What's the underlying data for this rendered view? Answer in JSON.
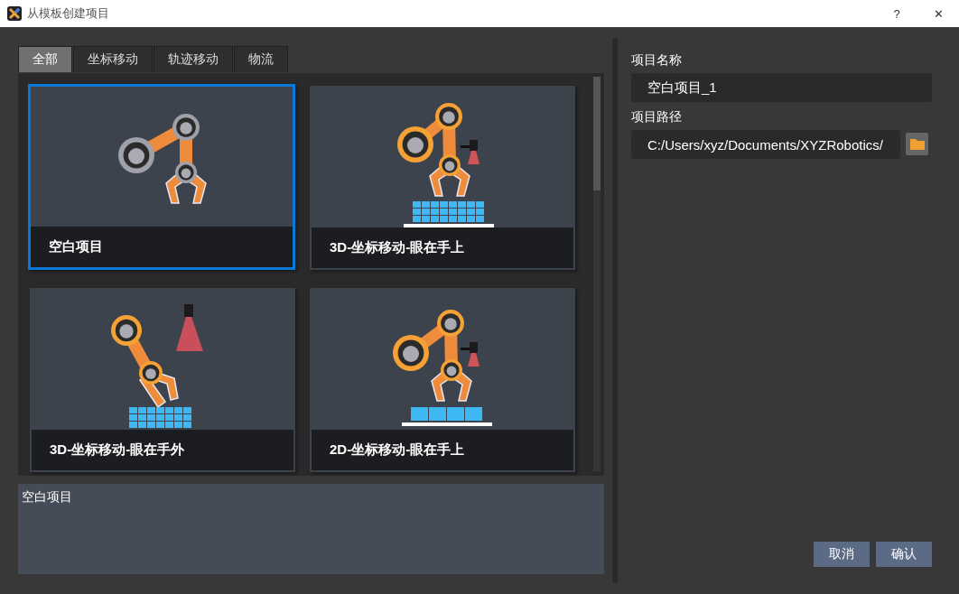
{
  "window": {
    "title": "从模板创建项目",
    "help": "?",
    "close": "✕"
  },
  "tabs": [
    {
      "label": "全部",
      "selected": true
    },
    {
      "label": "坐标移动",
      "selected": false
    },
    {
      "label": "轨迹移动",
      "selected": false
    },
    {
      "label": "物流",
      "selected": false
    }
  ],
  "templates": [
    {
      "title": "空白项目",
      "kind": "blank",
      "selected": true
    },
    {
      "title": "3D-坐标移动-眼在手上",
      "kind": "eyeinhand",
      "selected": false
    },
    {
      "title": "3D-坐标移动-眼在手外",
      "kind": "eyetohand",
      "selected": false
    },
    {
      "title": "2D-坐标移动-眼在手上",
      "kind": "planar",
      "selected": false
    }
  ],
  "description": "空白项目",
  "form": {
    "name_label": "项目名称",
    "name_value": "空白项目_1",
    "path_label": "项目路径",
    "path_value": "C:/Users/xyz/Documents/XYZRobotics/"
  },
  "buttons": [
    {
      "label": "取消"
    },
    {
      "label": "确认"
    }
  ]
}
